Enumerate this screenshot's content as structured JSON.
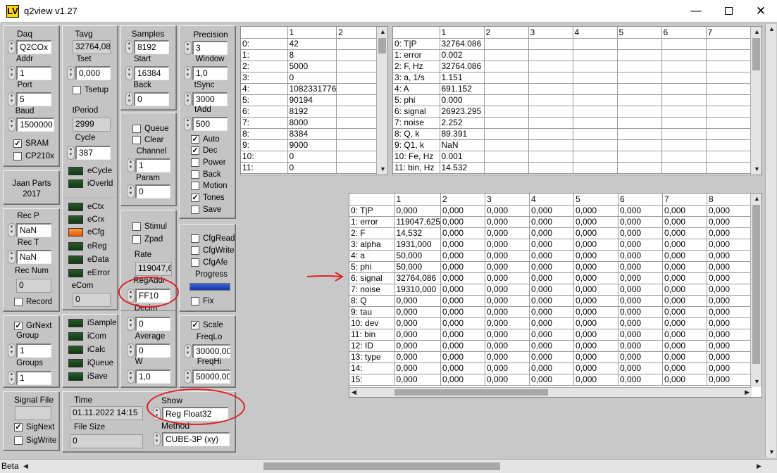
{
  "window": {
    "title": "q2view v1.27",
    "logo": "LV",
    "min_icon": "minimize-icon",
    "max_icon": "maximize-icon",
    "close_icon": "close-icon"
  },
  "daq": {
    "title": "Daq",
    "value": "Q2COx",
    "addr_label": "Addr",
    "addr": "1",
    "port_label": "Port",
    "port": "5",
    "baud_label": "Baud",
    "baud": "1500000",
    "sram_label": "SRAM",
    "sram": true,
    "cp210x_label": "CP210x",
    "cp210x": false
  },
  "tavg": {
    "title": "Tavg",
    "value": "32764,08",
    "tset_label": "Tset",
    "tset": "0,000",
    "tsetup_label": "Tsetup",
    "tperiod_label": "tPeriod",
    "tperiod": "2999",
    "cycle_label": "Cycle",
    "cycle": "387",
    "ecycle": "eCycle",
    "ioverld": "iOverld"
  },
  "samples": {
    "title": "Samples",
    "value": "8192",
    "start_label": "Start",
    "start": "16384",
    "back_label": "Back",
    "back": "0"
  },
  "precision": {
    "title": "Precision",
    "value": "3",
    "window_label": "Window",
    "window": "1,0",
    "tsync_label": "tSync",
    "tsync": "3000",
    "tadd_label": "tAdd",
    "tadd": "500"
  },
  "credits": {
    "line1": "Jaan Parts",
    "line2": "2017"
  },
  "rec": {
    "recp_label": "Rec P",
    "recp": "NaN",
    "rect_label": "Rec T",
    "rect": "NaN",
    "recnum_label": "Rec Num",
    "recnum": "0",
    "record_label": "Record"
  },
  "leds": {
    "ectx": "eCtx",
    "ecrx": "eCrx",
    "ecfg": "eCfg",
    "ereg": "eReg",
    "edata": "eData",
    "eerror": "eError",
    "ecom_label": "eCom",
    "ecom": "0",
    "led_on_color": "#f07820",
    "led_off_color": "#1f4a1f"
  },
  "queue": {
    "queue_label": "Queue",
    "clear_label": "Clear",
    "channel_label": "Channel",
    "channel": "1",
    "param_label": "Param",
    "param": "0"
  },
  "flags": {
    "auto_label": "Auto",
    "dec_label": "Dec",
    "power_label": "Power",
    "back_label": "Back",
    "motion_label": "Motion",
    "tones_label": "Tones",
    "save_label": "Save"
  },
  "stim": {
    "stimul_label": "Stimul",
    "zpad_label": "Zpad",
    "rate_label": "Rate",
    "rate": "119047,6",
    "regaddr_label": "RegAddr",
    "regaddr": "FF10"
  },
  "cfg": {
    "cfgread_label": "CfgRead",
    "cfgwrite_label": "CfgWrite",
    "cfgafe_label": "CfgAfe",
    "progress_label": "Progress",
    "progress": 1.0,
    "fix_label": "Fix"
  },
  "group": {
    "grnext_label": "GrNext",
    "group_label": "Group",
    "group": "1",
    "groups_label": "Groups",
    "groups": "1"
  },
  "isig": {
    "isample": "iSample",
    "icom": "iCom",
    "icalc": "iCalc",
    "iqueue": "iQueue",
    "isave": "iSave"
  },
  "decim": {
    "decim_label": "Decim",
    "decim": "0",
    "average_label": "Average",
    "average": "0",
    "w_label": "W",
    "w": "1,0"
  },
  "freq": {
    "scale_label": "Scale",
    "freqlo_label": "FreqLo",
    "freqlo": "30000,00",
    "freqhi_label": "FreqHi",
    "freqhi": "50000,00"
  },
  "signal": {
    "title": "Signal File",
    "signext_label": "SigNext",
    "sigwrite_label": "SigWrite"
  },
  "time": {
    "title": "Time",
    "value": "01.11.2022  14:15",
    "filesize_label": "File Size",
    "filesize": "0"
  },
  "show": {
    "title": "Show",
    "value": "Reg Float32",
    "method_label": "Method",
    "method": "CUBE-3P (xy)"
  },
  "grid1": {
    "headers": [
      "",
      "1",
      "2"
    ],
    "rows": [
      [
        "0:",
        "42"
      ],
      [
        "1:",
        "8"
      ],
      [
        "2:",
        "5000"
      ],
      [
        "3:",
        "0"
      ],
      [
        "4:",
        "1082331776"
      ],
      [
        "5:",
        "90194"
      ],
      [
        "6:",
        "8192"
      ],
      [
        "7:",
        "8000"
      ],
      [
        "8:",
        "8384"
      ],
      [
        "9:",
        "9000"
      ],
      [
        "10:",
        "0"
      ],
      [
        "11:",
        "0"
      ]
    ]
  },
  "grid2": {
    "headers": [
      "",
      "1",
      "2",
      "3",
      "4",
      "5",
      "6",
      "7"
    ],
    "rows": [
      [
        "0: T|P",
        "32764.086"
      ],
      [
        "1: error",
        "0.002"
      ],
      [
        "2: F, Hz",
        "32764.086"
      ],
      [
        "3: a, 1/s",
        "1.151"
      ],
      [
        "4: A",
        "691.152"
      ],
      [
        "5: phi",
        "0.000"
      ],
      [
        "6: signal",
        "26923.295"
      ],
      [
        "7: noise",
        "2.252"
      ],
      [
        "8: Q, k",
        "89.391"
      ],
      [
        "9: Q1, k",
        "NaN"
      ],
      [
        "10: Fe, Hz",
        "0.001"
      ],
      [
        "11: bin, Hz",
        "14.532"
      ]
    ]
  },
  "grid3": {
    "headers": [
      "",
      "1",
      "2",
      "3",
      "4",
      "5",
      "6",
      "7",
      "8"
    ],
    "rows": [
      [
        "0: T|P",
        "0,000"
      ],
      [
        "1: error",
        "119047,625"
      ],
      [
        "2: F",
        "14,532"
      ],
      [
        "3: alpha",
        "1931,000"
      ],
      [
        "4: a",
        "50,000"
      ],
      [
        "5: phi",
        "50,000"
      ],
      [
        "6: signal",
        "32764,086"
      ],
      [
        "7: noise",
        "19310,000"
      ],
      [
        "8: Q",
        "0,000"
      ],
      [
        "9: tau",
        "0,000"
      ],
      [
        "10: dev",
        "0,000"
      ],
      [
        "11: bin",
        "0,000"
      ],
      [
        "12: ID",
        "0,000"
      ],
      [
        "13: type",
        "0,000"
      ],
      [
        "14:",
        "0,000"
      ],
      [
        "15:",
        "0,000"
      ]
    ],
    "fill": "0,000"
  },
  "status": {
    "beta": "Beta"
  },
  "annotation_color": "#e02020"
}
